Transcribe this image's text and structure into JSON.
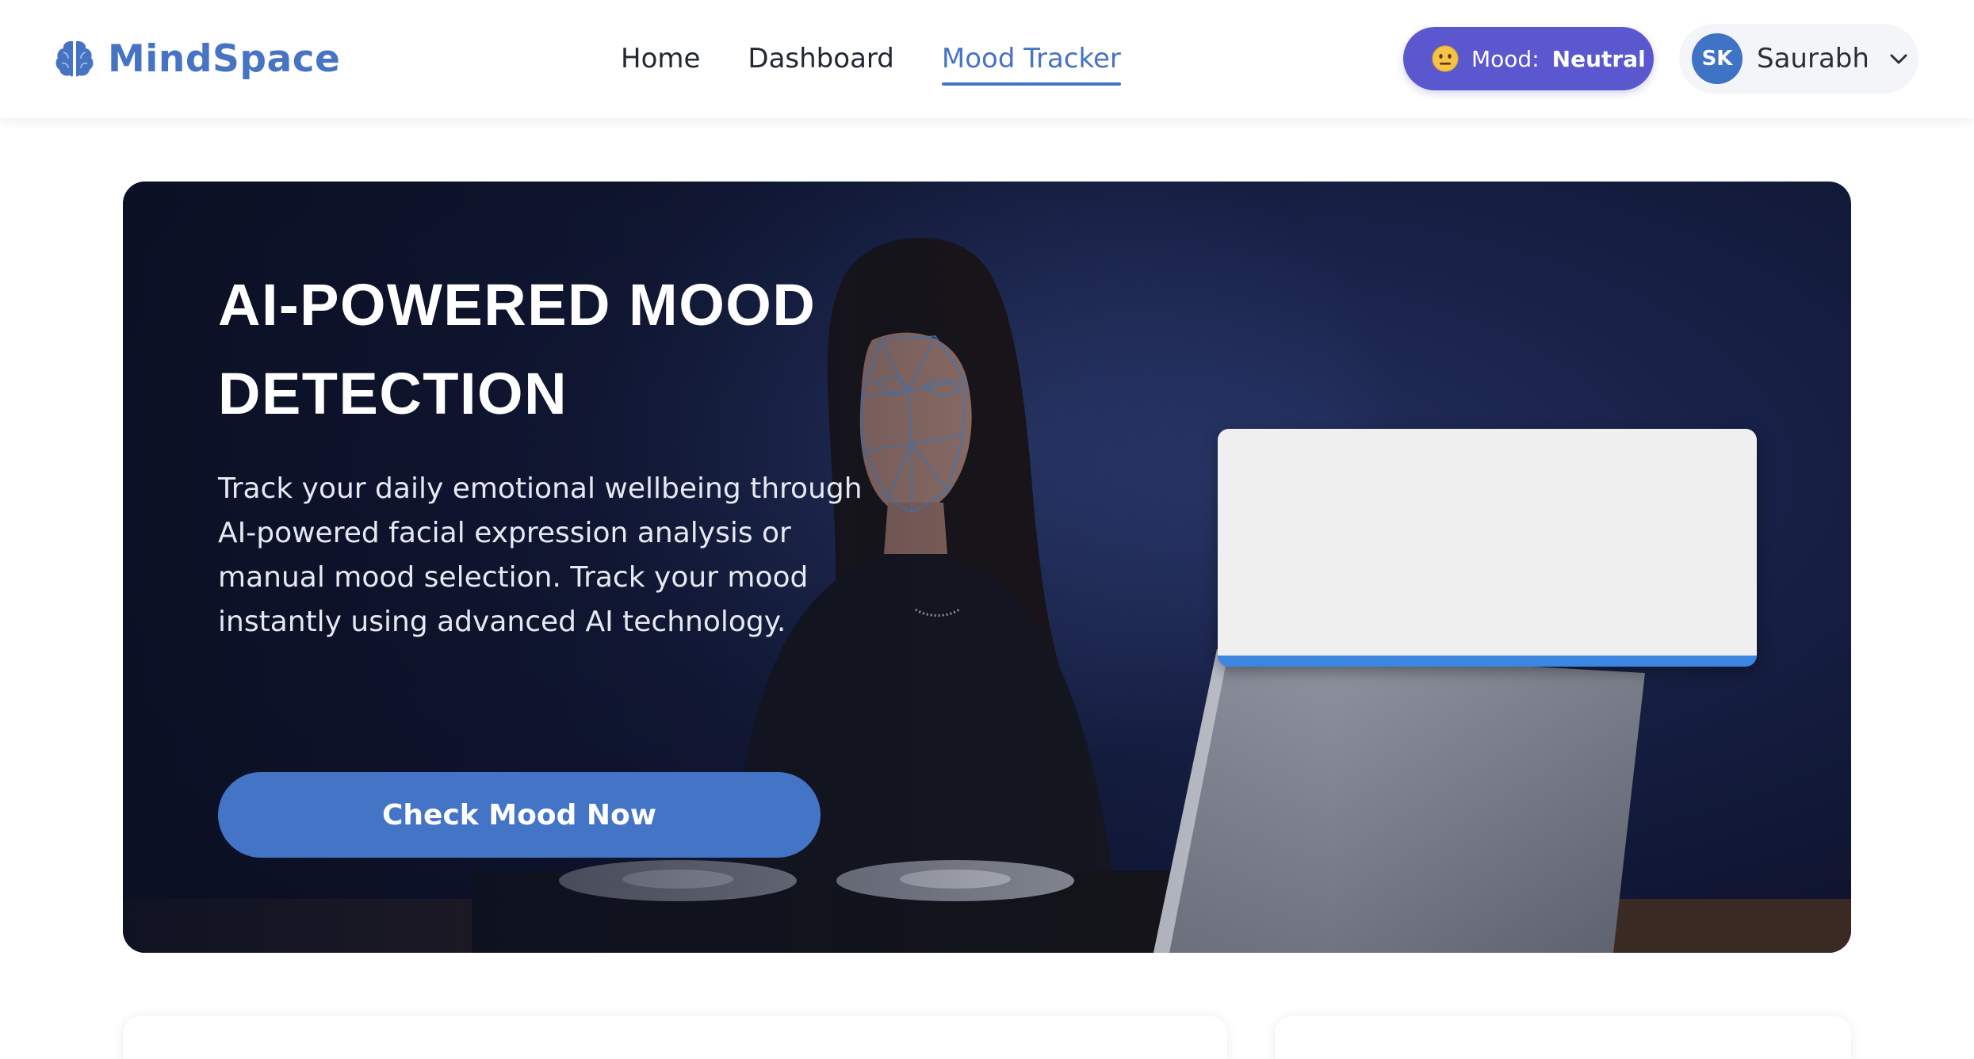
{
  "brand": {
    "name": "MindSpace",
    "icon": "brain-icon",
    "color": "#4674c3"
  },
  "nav": {
    "links": [
      {
        "label": "Home",
        "active": false
      },
      {
        "label": "Dashboard",
        "active": false
      },
      {
        "label": "Mood Tracker",
        "active": true
      }
    ]
  },
  "mood_pill": {
    "label": "Mood:",
    "value": "Neutral",
    "icon": "neutral-face-icon",
    "color": "#5a57cf"
  },
  "user": {
    "initials": "SK",
    "name": "Saurabh",
    "icon": "chevron-down-icon"
  },
  "hero": {
    "title": "AI-POWERED MOOD DETECTION",
    "description": "Track your daily emotional wellbeing through AI-powered facial expression analysis or manual mood selection. Track your mood instantly using advanced AI technology.",
    "cta_label": "Check Mood Now",
    "cta_color": "#4474c6"
  },
  "colors": {
    "accent": "#4674c3",
    "panel_border": "#3b86e0"
  }
}
